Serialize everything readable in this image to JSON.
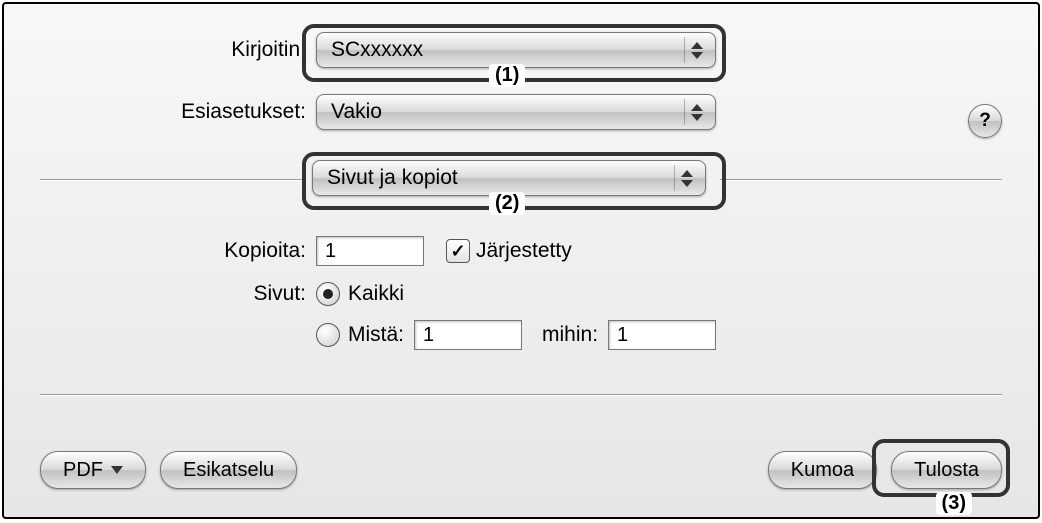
{
  "labels": {
    "printer": "Kirjoitin:",
    "presets": "Esiasetukset:",
    "copies": "Kopioita:",
    "collated": "Järjestetty",
    "pages": "Sivut:",
    "all": "Kaikki",
    "from": "Mistä:",
    "to": "mihin:"
  },
  "values": {
    "printer": "SCxxxxxx",
    "presets": "Vakio",
    "pane": "Sivut ja kopiot",
    "copies": "1",
    "collated_checked": "✓",
    "from": "1",
    "to": "1"
  },
  "callouts": {
    "c1": "(1)",
    "c2": "(2)",
    "c3": "(3)"
  },
  "buttons": {
    "help": "?",
    "pdf": "PDF",
    "preview": "Esikatselu",
    "cancel": "Kumoa",
    "print": "Tulosta"
  }
}
